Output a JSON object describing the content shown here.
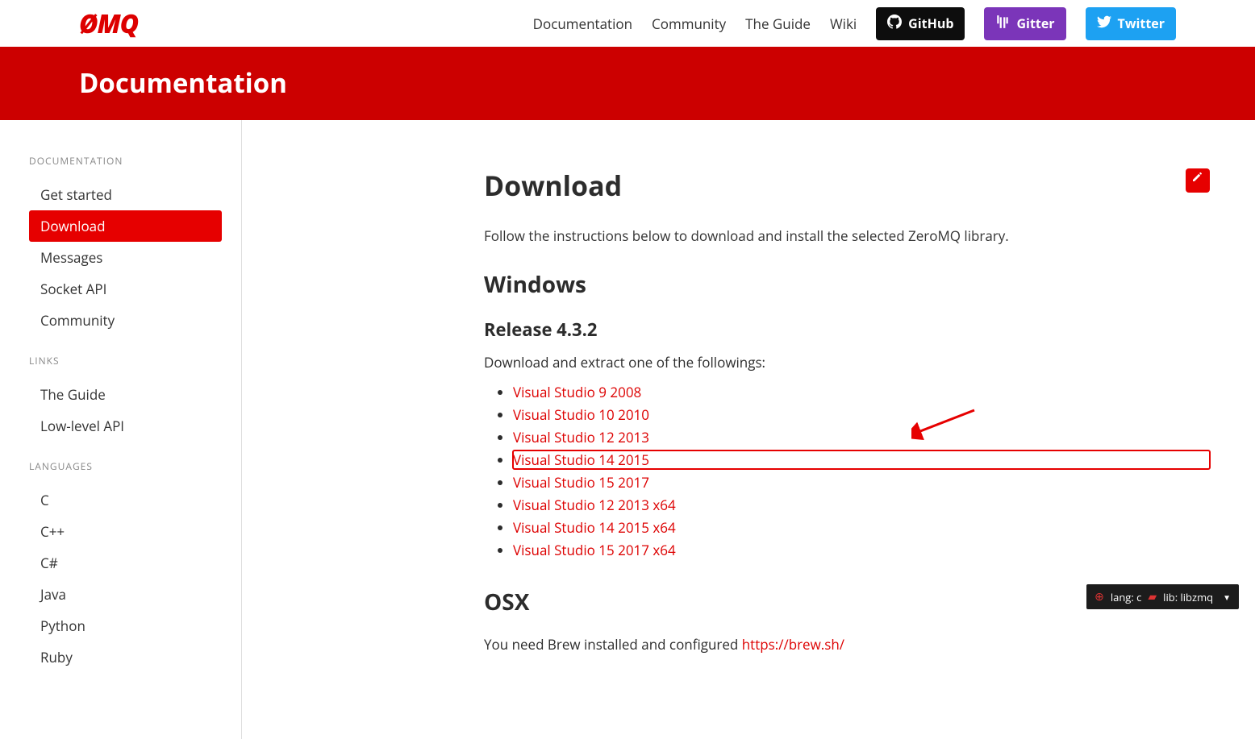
{
  "logo_text": "ØMQ",
  "topnav": {
    "links": [
      {
        "label": "Documentation"
      },
      {
        "label": "Community"
      },
      {
        "label": "The Guide"
      },
      {
        "label": "Wiki"
      }
    ],
    "buttons": {
      "github": "GitHub",
      "gitter": "Gitter",
      "twitter": "Twitter"
    }
  },
  "banner": {
    "title": "Documentation"
  },
  "sidebar": {
    "sections": [
      {
        "title": "DOCUMENTATION",
        "items": [
          {
            "label": "Get started",
            "active": false
          },
          {
            "label": "Download",
            "active": true
          },
          {
            "label": "Messages",
            "active": false
          },
          {
            "label": "Socket API",
            "active": false
          },
          {
            "label": "Community",
            "active": false
          }
        ]
      },
      {
        "title": "LINKS",
        "items": [
          {
            "label": "The Guide"
          },
          {
            "label": "Low-level API"
          }
        ]
      },
      {
        "title": "LANGUAGES",
        "items": [
          {
            "label": "C"
          },
          {
            "label": "C++"
          },
          {
            "label": "C#"
          },
          {
            "label": "Java"
          },
          {
            "label": "Python"
          },
          {
            "label": "Ruby"
          }
        ]
      }
    ]
  },
  "content": {
    "title": "Download",
    "intro": "Follow the instructions below to download and install the selected ZeroMQ library.",
    "windows_heading": "Windows",
    "release_heading": "Release 4.3.2",
    "release_lead": "Download and extract one of the followings:",
    "downloads": [
      {
        "label": "Visual Studio 9 2008",
        "highlight": false
      },
      {
        "label": "Visual Studio 10 2010",
        "highlight": false
      },
      {
        "label": "Visual Studio 12 2013",
        "highlight": false
      },
      {
        "label": "Visual Studio 14 2015",
        "highlight": true
      },
      {
        "label": "Visual Studio 15 2017",
        "highlight": false
      },
      {
        "label": "Visual Studio 12 2013 x64",
        "highlight": false
      },
      {
        "label": "Visual Studio 14 2015 x64",
        "highlight": false
      },
      {
        "label": "Visual Studio 15 2017 x64",
        "highlight": false
      }
    ],
    "osx_heading": "OSX",
    "osx_lead": "You need Brew installed and configured ",
    "osx_link": "https://brew.sh/"
  },
  "pill": {
    "lang_label": "lang: c",
    "lib_label": "lib: libzmq"
  }
}
